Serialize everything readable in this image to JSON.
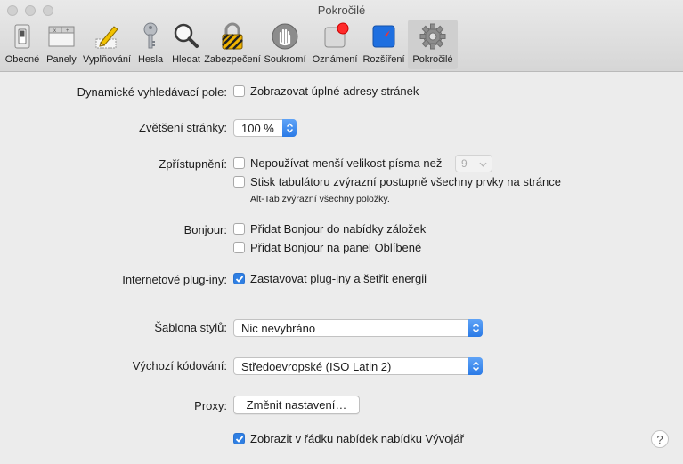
{
  "window": {
    "title": "Pokročilé"
  },
  "toolbar": {
    "items": [
      {
        "label": "Obecné",
        "icon": "switch-icon"
      },
      {
        "label": "Panely",
        "icon": "tabs-icon"
      },
      {
        "label": "Vyplňování",
        "icon": "pencil-icon"
      },
      {
        "label": "Hesla",
        "icon": "key-icon"
      },
      {
        "label": "Hledat",
        "icon": "magnifier-icon"
      },
      {
        "label": "Zabezpečení",
        "icon": "padlock-icon"
      },
      {
        "label": "Soukromí",
        "icon": "hand-icon"
      },
      {
        "label": "Oznámení",
        "icon": "notification-icon"
      },
      {
        "label": "Rozšíření",
        "icon": "compass-icon"
      },
      {
        "label": "Pokročilé",
        "icon": "gear-icon"
      }
    ],
    "selected": "Pokročilé"
  },
  "settings": {
    "smart_search": {
      "label": "Dynamické vyhledávací pole:",
      "option": "Zobrazovat úplné adresy stránek",
      "checked": false
    },
    "zoom": {
      "label": "Zvětšení stránky:",
      "value": "100 %"
    },
    "accessibility": {
      "label": "Zpřístupnění:",
      "min_font": {
        "text": "Nepoužívat menší velikost písma než",
        "checked": false,
        "value": "9"
      },
      "tab_highlight": {
        "text": "Stisk tabulátoru zvýrazní postupně všechny prvky na stránce",
        "checked": false
      },
      "note": "Alt-Tab zvýrazní všechny položky."
    },
    "bonjour": {
      "label": "Bonjour:",
      "bookmarks": {
        "text": "Přidat Bonjour do nabídky záložek",
        "checked": false
      },
      "favorites": {
        "text": "Přidat Bonjour na panel Oblíbené",
        "checked": false
      }
    },
    "plugins": {
      "label": "Internetové plug-iny:",
      "text": "Zastavovat plug-iny a šetřit energii",
      "checked": true
    },
    "stylesheet": {
      "label": "Šablona stylů:",
      "value": "Nic nevybráno"
    },
    "encoding": {
      "label": "Výchozí kódování:",
      "value": "Středoevropské (ISO Latin 2)"
    },
    "proxy": {
      "label": "Proxy:",
      "button": "Změnit nastavení…"
    },
    "develop_menu": {
      "text": "Zobrazit v řádku nabídek nabídku Vývojář",
      "checked": true
    },
    "help": {
      "symbol": "?"
    }
  },
  "colors": {
    "accent": "#2f7fe3",
    "notification_badge": "#ff2a2a"
  }
}
